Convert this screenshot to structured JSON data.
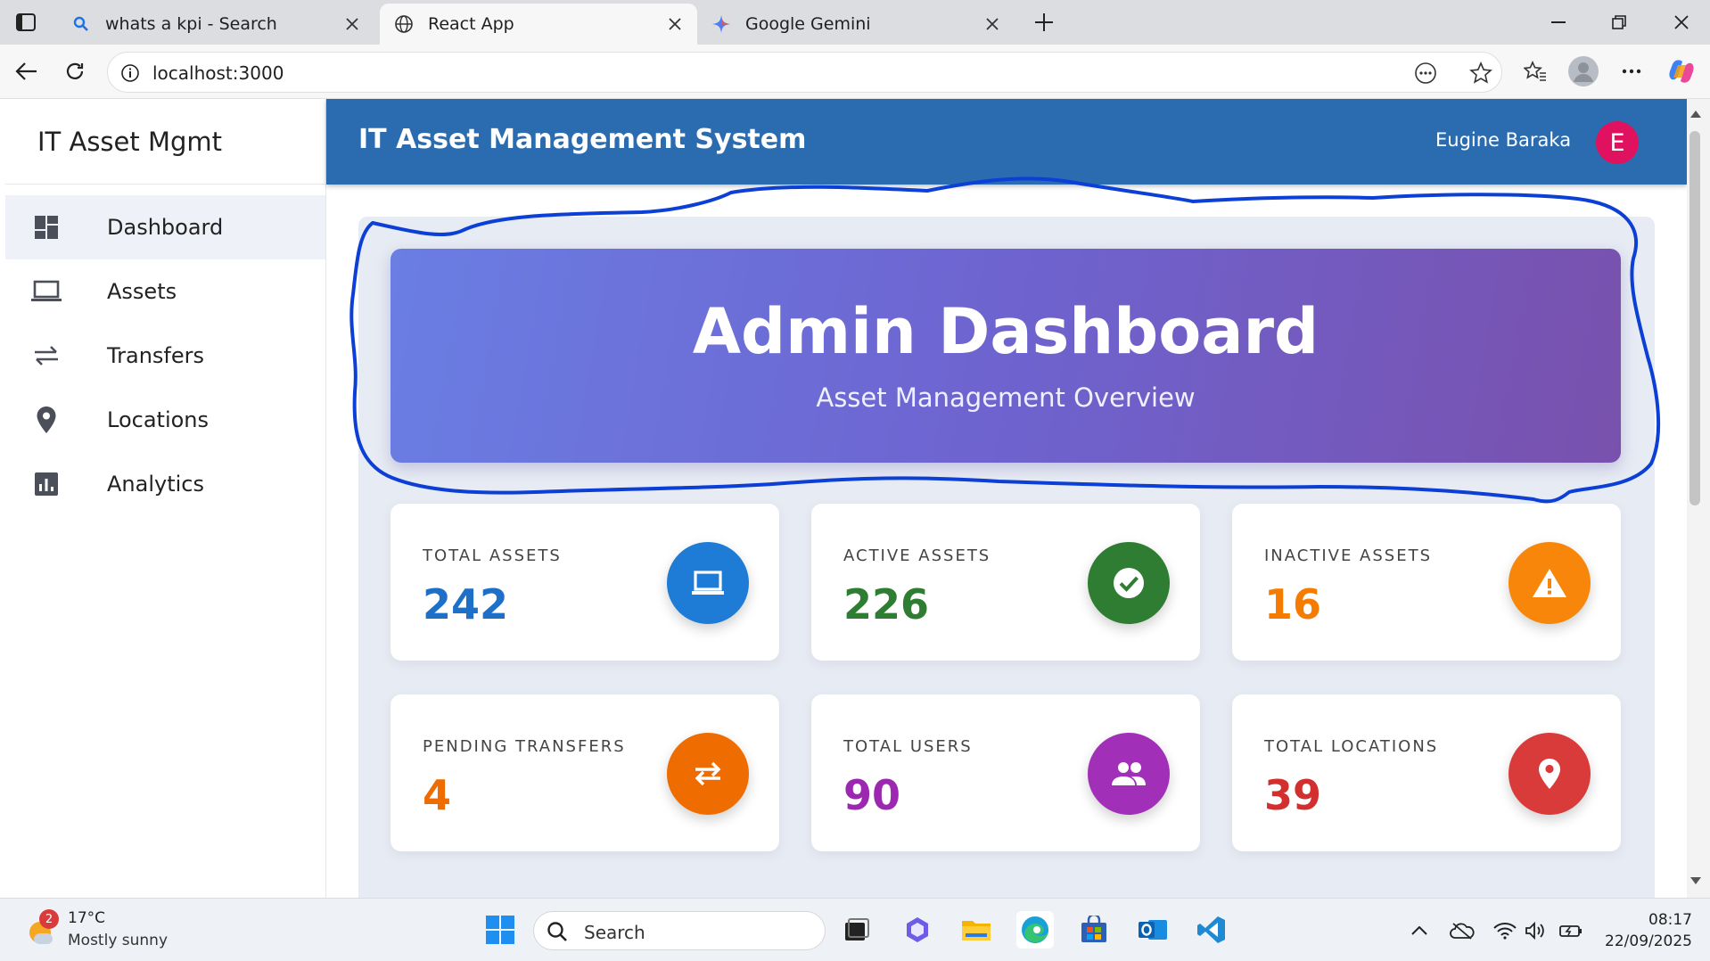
{
  "browser": {
    "tabs": [
      {
        "title": "whats a kpi - Search",
        "favicon": "search-icon"
      },
      {
        "title": "React App",
        "favicon": "globe-icon"
      },
      {
        "title": "Google Gemini",
        "favicon": "gemini-icon"
      }
    ],
    "url": "localhost:3000"
  },
  "sidebar": {
    "brand": "IT Asset Mgmt",
    "items": [
      {
        "label": "Dashboard",
        "icon": "dashboard-icon",
        "active": true
      },
      {
        "label": "Assets",
        "icon": "laptop-icon"
      },
      {
        "label": "Transfers",
        "icon": "transfer-icon"
      },
      {
        "label": "Locations",
        "icon": "location-pin-icon"
      },
      {
        "label": "Analytics",
        "icon": "analytics-icon"
      }
    ]
  },
  "header": {
    "title": "IT Asset Management System",
    "user_name": "Eugine Baraka",
    "avatar_initial": "E",
    "avatar_color": "#e0115f",
    "bg_color": "#2b6cb0"
  },
  "hero": {
    "title": "Admin Dashboard",
    "subtitle": "Asset Management Overview"
  },
  "stats": [
    {
      "label": "TOTAL ASSETS",
      "value": "242",
      "color": "#1e6fc8",
      "icon": "laptop-icon"
    },
    {
      "label": "ACTIVE ASSETS",
      "value": "226",
      "color": "#2e7d32",
      "icon": "check-circle-icon"
    },
    {
      "label": "INACTIVE ASSETS",
      "value": "16",
      "color": "#f57c00",
      "icon": "warning-icon"
    },
    {
      "label": "PENDING TRANSFERS",
      "value": "4",
      "color": "#ef6c00",
      "icon": "transfer-icon"
    },
    {
      "label": "TOTAL USERS",
      "value": "90",
      "color": "#9c27b0",
      "icon": "users-icon"
    },
    {
      "label": "TOTAL LOCATIONS",
      "value": "39",
      "color": "#d32f2f",
      "icon": "location-pin-icon"
    }
  ],
  "taskbar": {
    "weather": {
      "badge": "2",
      "temp": "17°C",
      "condition": "Mostly sunny"
    },
    "search_label": "Search",
    "time": "08:17",
    "date": "22/09/2025"
  }
}
